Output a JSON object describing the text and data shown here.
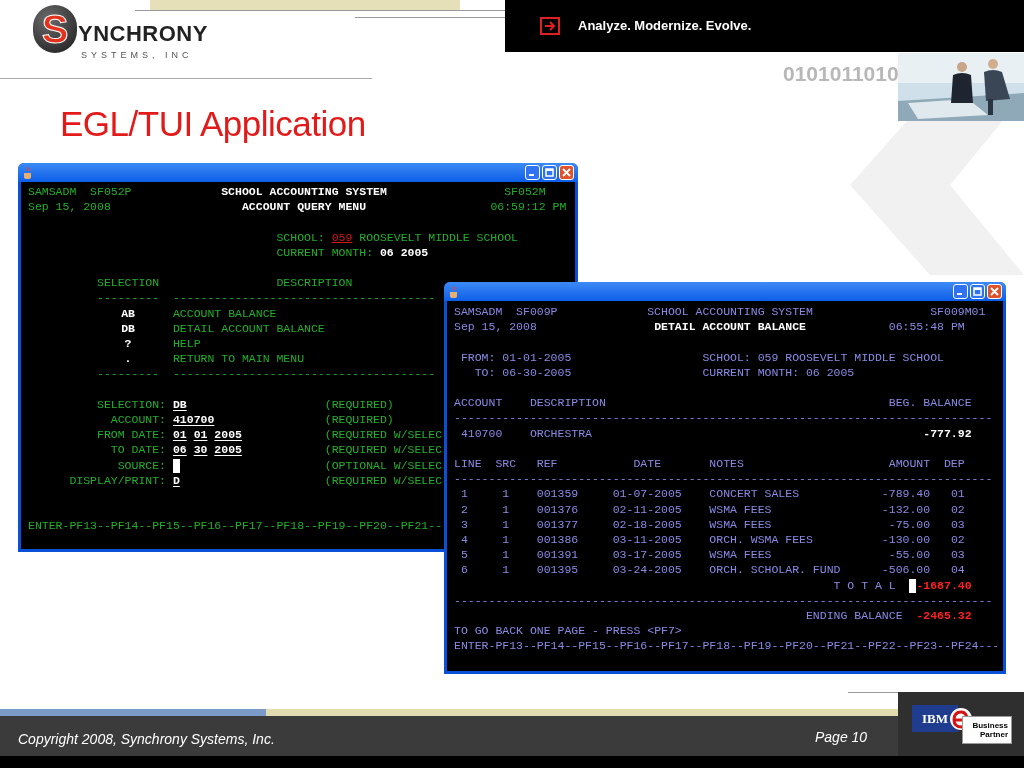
{
  "logo": {
    "initial": "S",
    "name": "YNCHRONY",
    "tagline": "SYSTEMS, INC"
  },
  "banner": {
    "slogan": "Analyze. Modernize. Evolve.",
    "binary": "0101011010"
  },
  "title": "EGL/TUI Application",
  "query_window": {
    "header": {
      "user": "SAMSADM",
      "program": "SF052P",
      "system": "SCHOOL ACCOUNTING SYSTEM",
      "map": "SF052M",
      "date": "Sep 15, 2008",
      "screen": "ACCOUNT QUERY MENU",
      "time": "06:59:12 PM"
    },
    "school": {
      "label": "SCHOOL:",
      "code": "059",
      "name": "ROOSEVELT MIDDLE SCHOOL"
    },
    "month": {
      "label": "CURRENT MONTH:",
      "value": "06 2005"
    },
    "menu": {
      "columns": [
        "SELECTION",
        "DESCRIPTION"
      ],
      "rules": [
        "---------",
        "--------------------------------------"
      ],
      "items": [
        {
          "code": "AB",
          "description": "ACCOUNT BALANCE"
        },
        {
          "code": "DB",
          "description": "DETAIL ACCOUNT BALANCE"
        },
        {
          "code": "?",
          "description": "HELP"
        },
        {
          "code": ".",
          "description": "RETURN TO MAIN MENU"
        }
      ],
      "bottom_rules": [
        "---------",
        "--------------------------------------"
      ]
    },
    "fields": [
      {
        "label": "SELECTION:",
        "values": [
          "DB"
        ],
        "note": "(REQUIRED)",
        "cursor": false
      },
      {
        "label": "ACCOUNT:",
        "values": [
          "410700"
        ],
        "note": "(REQUIRED)",
        "cursor": false
      },
      {
        "label": "FROM DATE:",
        "values": [
          "01",
          "01",
          "2005"
        ],
        "note": "(REQUIRED W/SELEC",
        "cursor": false
      },
      {
        "label": "TO DATE:",
        "values": [
          "06",
          "30",
          "2005"
        ],
        "note": "(REQUIRED W/SELEC",
        "cursor": false
      },
      {
        "label": "SOURCE:",
        "note": "(OPTIONAL W/SELEC",
        "cursor": true
      },
      {
        "label": "DISPLAY/PRINT:",
        "values": [
          "D"
        ],
        "note": "(REQUIRED W/SELEC",
        "cursor": false
      }
    ],
    "keys": "ENTER-PF13--PF14--PF15--PF16--PF17--PF18--PF19--PF20--PF21--"
  },
  "detail_window": {
    "header": {
      "user": "SAMSADM",
      "program": "SF009P",
      "system": "SCHOOL ACCOUNTING SYSTEM",
      "map": "SF009M01",
      "date": "Sep 15, 2008",
      "screen": "DETAIL ACCOUNT BALANCE",
      "time": "06:55:48 PM"
    },
    "range": [
      {
        "label": "FROM:",
        "value": "01-01-2005"
      },
      {
        "label": "TO:",
        "value": "06-30-2005"
      }
    ],
    "school": {
      "label": "SCHOOL:",
      "value": "059 ROOSEVELT MIDDLE SCHOOL"
    },
    "month": {
      "label": "CURRENT MONTH:",
      "value": "06 2005"
    },
    "account_table": {
      "columns": [
        "ACCOUNT",
        "DESCRIPTION",
        "BEG. BALANCE"
      ],
      "rule": "------------------------------------------------------------------------------",
      "rows": [
        [
          "410700",
          "ORCHESTRA",
          "-777.92"
        ]
      ]
    },
    "lines_table": {
      "columns": [
        "LINE",
        "SRC",
        "REF",
        "DATE",
        "NOTES",
        "AMOUNT",
        "DEP"
      ],
      "rule": "------------------------------------------------------------------------------",
      "rows": [
        [
          "1",
          "1",
          "001359",
          "01-07-2005",
          "CONCERT SALES",
          "-789.40",
          "01"
        ],
        [
          "2",
          "1",
          "001376",
          "02-11-2005",
          "WSMA FEES",
          "-132.00",
          "02"
        ],
        [
          "3",
          "1",
          "001377",
          "02-18-2005",
          "WSMA FEES",
          "-75.00",
          "03"
        ],
        [
          "4",
          "1",
          "001386",
          "03-11-2005",
          "ORCH. WSMA FEES",
          "-130.00",
          "02"
        ],
        [
          "5",
          "1",
          "001391",
          "03-17-2005",
          "WSMA FEES",
          "-55.00",
          "03"
        ],
        [
          "6",
          "1",
          "001395",
          "03-24-2005",
          "ORCH. SCHOLAR. FUND",
          "-506.00",
          "04"
        ]
      ]
    },
    "total": {
      "label": "T O T A L",
      "cursor": true,
      "value": "-1687.40"
    },
    "rule": "------------------------------------------------------------------------------",
    "ending_balance": {
      "label": "ENDING BALANCE",
      "value": "-2465.32"
    },
    "hint": "TO GO BACK ONE PAGE - PRESS <PF7>",
    "keys": "ENTER-PF13--PF14--PF15--PF16--PF17--PF18--PF19--PF20--PF21--PF22--PF23--PF24---"
  },
  "footer": {
    "copyright": "Copyright 2008, Synchrony Systems, Inc.",
    "page": "Page 10",
    "partner_badge": {
      "brand": "IBM",
      "line1": "Business",
      "line2": "Partner"
    }
  }
}
